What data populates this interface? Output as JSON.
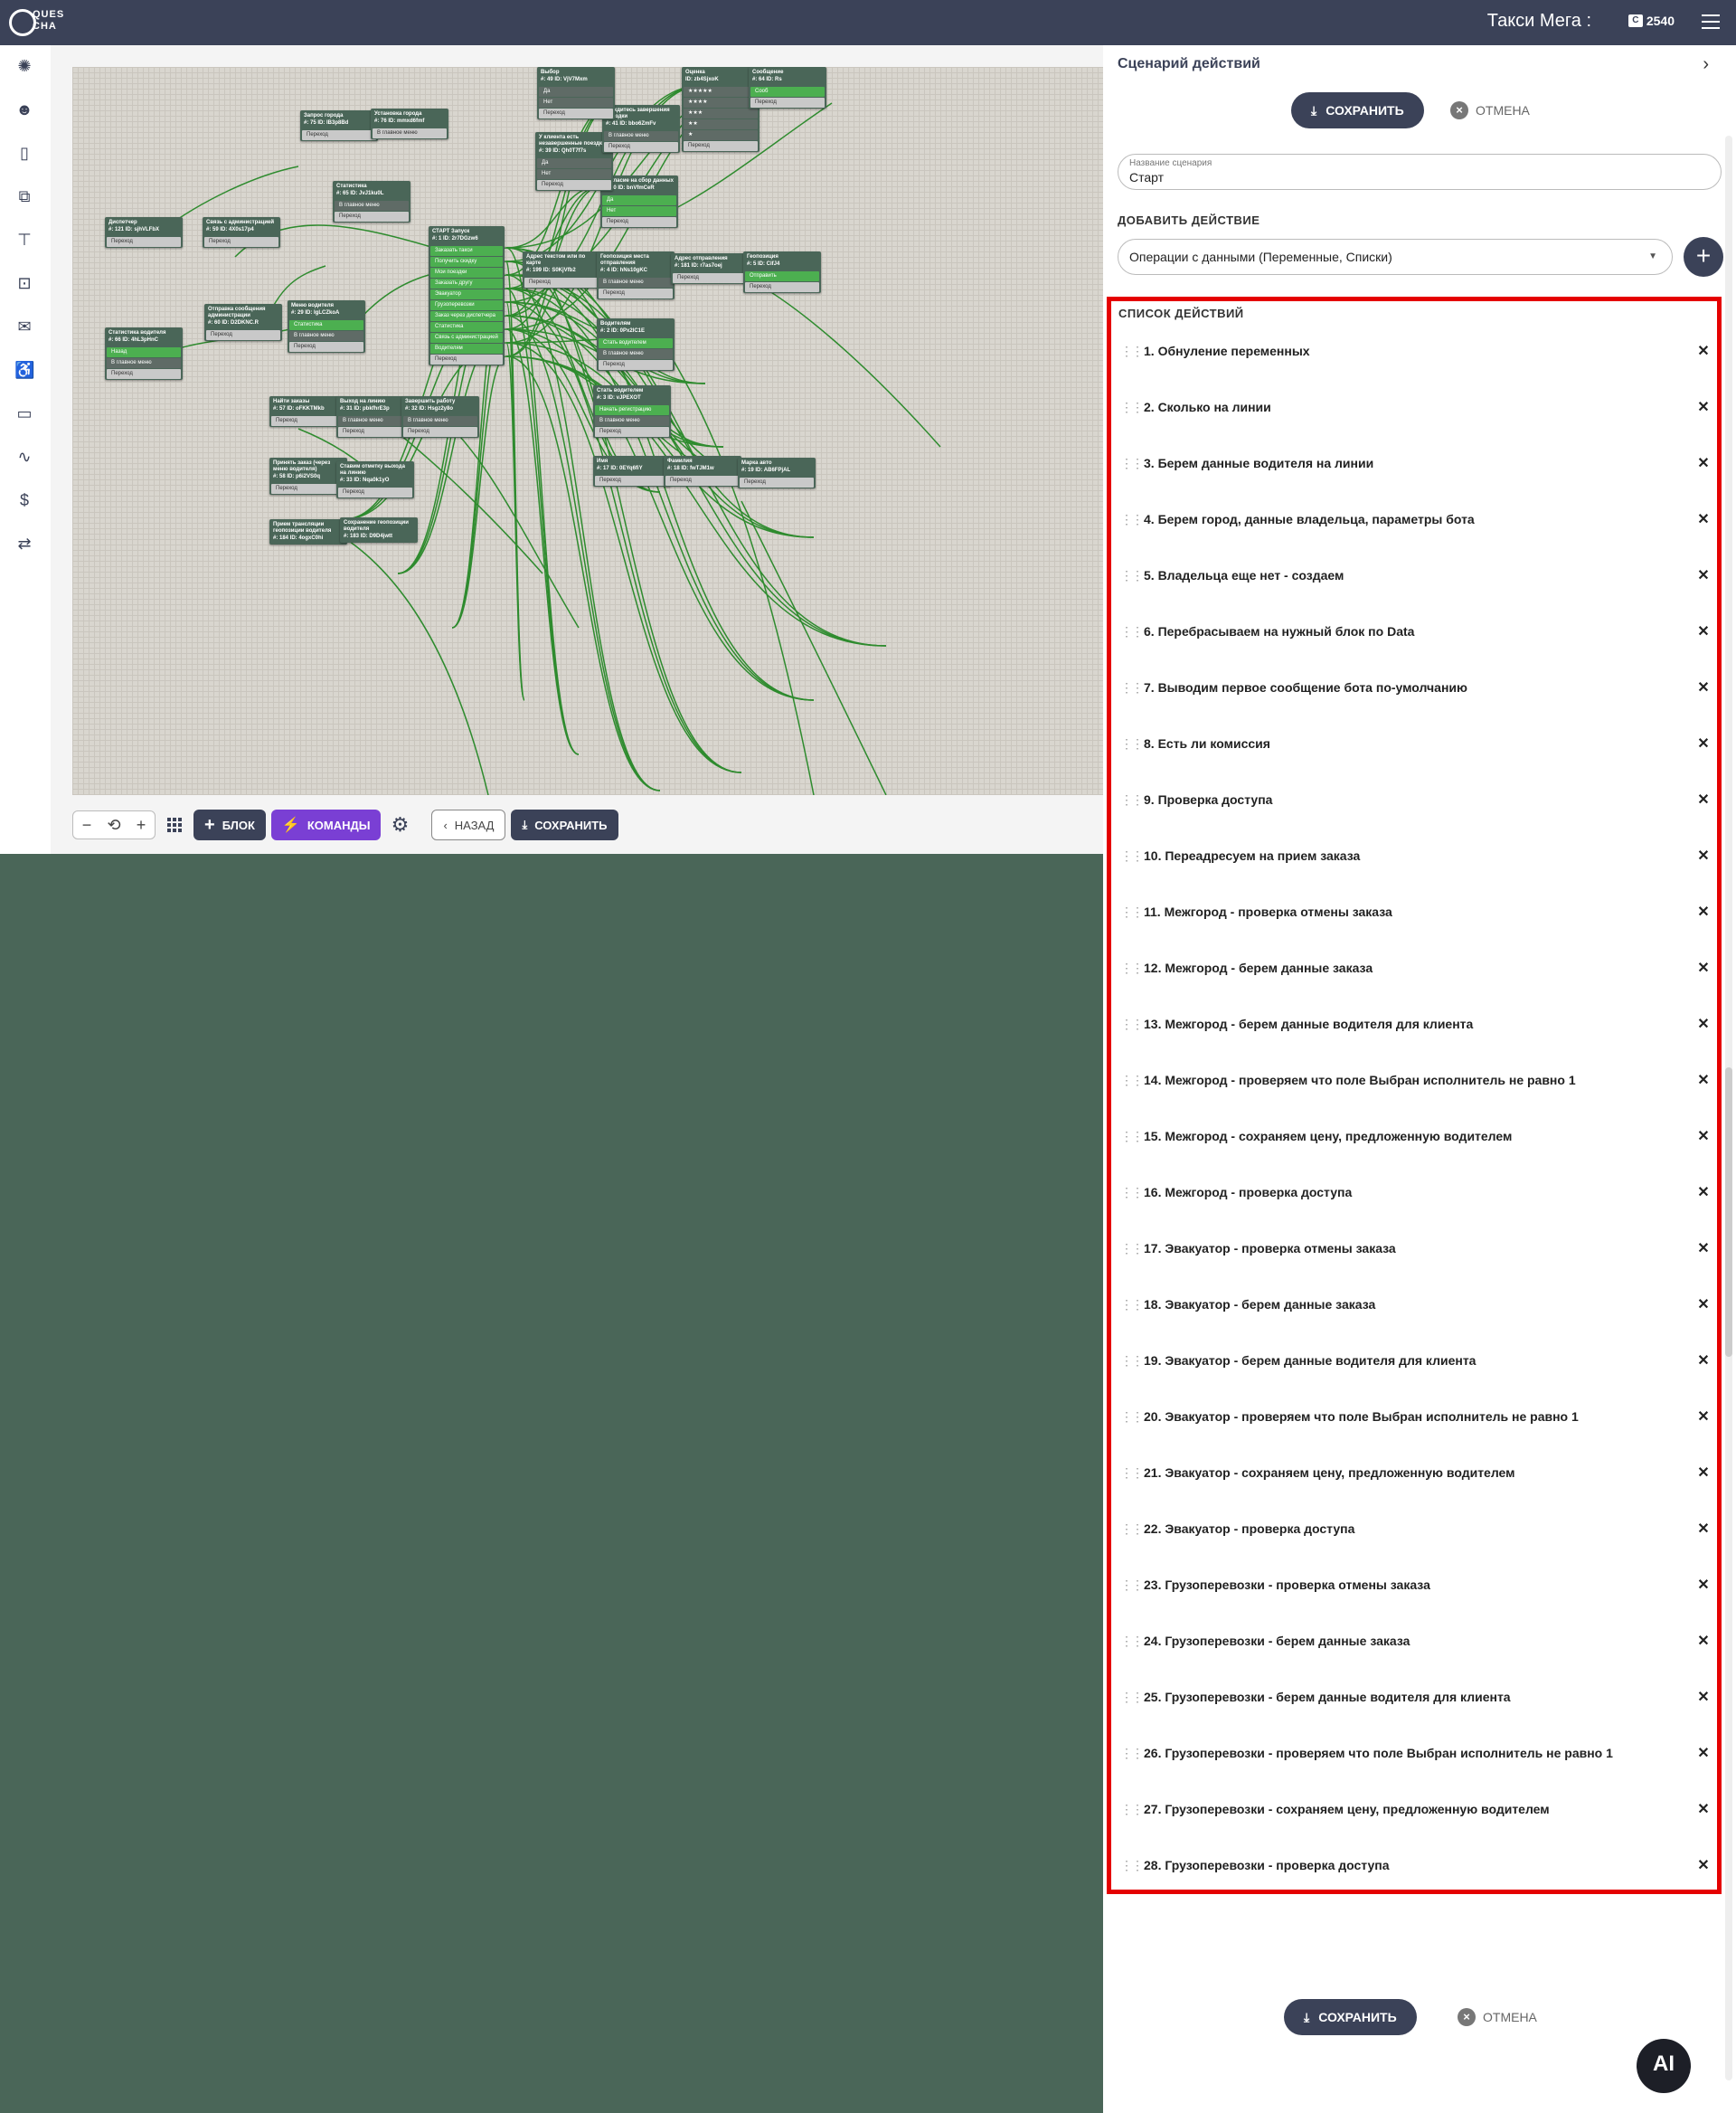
{
  "header": {
    "logo_text": "QUES CHA",
    "brand": "Такси Мега :",
    "balance": "2540",
    "balance_icon": "coin-icon",
    "menu_icon": "hamburger-icon"
  },
  "sidebar": {
    "icons": [
      "palette-icon",
      "robot-icon",
      "phone-icon",
      "flowchart-icon",
      "paint-roller-icon",
      "face-scan-icon",
      "chat-icon",
      "accessibility-icon",
      "card-icon",
      "route-icon",
      "dollar-icon",
      "swap-icon"
    ]
  },
  "canvas": {
    "nodes": [
      {
        "title": "Запрос города",
        "id": "#: 75  ID: lB3p8Bd",
        "buttons": [
          [
            "Переход",
            "n"
          ]
        ]
      },
      {
        "title": "Установка города",
        "id": "#: 76  ID: mmxd6fmf",
        "buttons": [
          [
            "В главное меню",
            "n"
          ]
        ]
      },
      {
        "title": "Статистика",
        "id": "#: 65  ID: JvJ1ku0L",
        "buttons": [
          [
            "В главное меню",
            "d"
          ],
          [
            "Переход",
            "n"
          ]
        ]
      },
      {
        "title": "Диспетчер",
        "id": "#: 121  ID: sjhVLFbX",
        "buttons": [
          [
            "Переход",
            "n"
          ]
        ]
      },
      {
        "title": "Связь с администрацией",
        "id": "#: 59  ID: 4X0s17p4",
        "buttons": [
          [
            "Переход",
            "n"
          ]
        ]
      },
      {
        "title": "Статистика водителя",
        "id": "#: 66  ID: 4hL3pHnC",
        "buttons": [
          [
            "Назад",
            "g"
          ],
          [
            "В главное меню",
            "d"
          ],
          [
            "Переход",
            "n"
          ]
        ]
      },
      {
        "title": "Отправка сообщения администрации",
        "id": "#: 60  ID: D2DKNC.R",
        "buttons": [
          [
            "Переход",
            "n"
          ]
        ]
      },
      {
        "title": "Меню водителя",
        "id": "#: 29  ID: IgLCZkoA",
        "buttons": [
          [
            "Статистика",
            "g"
          ],
          [
            "В главное меню",
            "d"
          ],
          [
            "Переход",
            "n"
          ]
        ]
      },
      {
        "title": "СТАРТ  Запуск",
        "id": "#: 1  ID: 2r7DGzw6",
        "buttons": [
          [
            "Заказать такси",
            "g"
          ],
          [
            "Получить скидку",
            "g"
          ],
          [
            "Мои поездки",
            "g"
          ],
          [
            "Заказать другу",
            "g"
          ],
          [
            "Эвакуатор",
            "g"
          ],
          [
            "Грузоперевозки",
            "g"
          ],
          [
            "Заказ через диспетчера",
            "g"
          ],
          [
            "Статистика",
            "g"
          ],
          [
            "Связь с администрацией",
            "g"
          ],
          [
            "Водителям",
            "g"
          ],
          [
            "Переход",
            "n"
          ]
        ]
      },
      {
        "title": "Найти заказы",
        "id": "#: 57  ID: oFKKTMkb",
        "buttons": [
          [
            "Переход",
            "n"
          ]
        ]
      },
      {
        "title": "Выход на линию",
        "id": "#: 31  ID: pbkfhrE3p",
        "buttons": [
          [
            "В главное меню",
            "d"
          ],
          [
            "Переход",
            "n"
          ]
        ]
      },
      {
        "title": "Завершить работу",
        "id": "#: 32  ID: Hsgz2y8o",
        "buttons": [
          [
            "В главное меню",
            "d"
          ],
          [
            "Переход",
            "n"
          ]
        ]
      },
      {
        "title": "Принять заказ (через меню водителя)",
        "id": "#: 58  ID: p6i2VS0q",
        "buttons": [
          [
            "Переход",
            "n"
          ]
        ]
      },
      {
        "title": "Ставим отметку выхода на линию",
        "id": "#: 33  ID: Nqa0k1yO",
        "buttons": [
          [
            "Переход",
            "n"
          ]
        ]
      },
      {
        "title": "Прием трансляции геопозиции водителя",
        "id": "#: 184  ID: 4ogxC0hi",
        "buttons": []
      },
      {
        "title": "Сохранение геопозиции водителя",
        "id": "#: 183  ID: D9D4jwtt",
        "buttons": []
      },
      {
        "title": "Адрес текстом или по карте",
        "id": "#: 199  ID: S0KjVfb2",
        "buttons": [
          [
            "Переход",
            "n"
          ]
        ]
      },
      {
        "title": "Геопозиция места отправления",
        "id": "#: 4  ID: hNs10gKC",
        "buttons": [
          [
            "В главное меню",
            "d"
          ],
          [
            "Переход",
            "n"
          ]
        ]
      },
      {
        "title": "Адрес отправления",
        "id": "#: 181  ID: r7as7oej",
        "buttons": [
          [
            "Переход",
            "n"
          ]
        ]
      },
      {
        "title": "Геопозиция",
        "id": "#: 5  ID: CifJ4",
        "buttons": [
          [
            "Отправить",
            "g"
          ],
          [
            "Переход",
            "n"
          ]
        ]
      },
      {
        "title": "Водителям",
        "id": "#: 2  ID: 0Px2lC1E",
        "buttons": [
          [
            "Стать водителем",
            "g"
          ],
          [
            "В главное меню",
            "d"
          ],
          [
            "Переход",
            "n"
          ]
        ]
      },
      {
        "title": "Стать водителем",
        "id": "#: 3  ID: vJPEXOT",
        "buttons": [
          [
            "Начать регистрацию",
            "g"
          ],
          [
            "В главное меню",
            "d"
          ],
          [
            "Переход",
            "n"
          ]
        ]
      },
      {
        "title": "Имя",
        "id": "#: 17  ID: 0EYq6fiY",
        "buttons": [
          [
            "Переход",
            "n"
          ]
        ]
      },
      {
        "title": "Фамилия",
        "id": "#: 18  ID: fwTJM1w",
        "buttons": [
          [
            "Переход",
            "n"
          ]
        ]
      },
      {
        "title": "Марка авто",
        "id": "#: 19  ID: AB6FPjAL",
        "buttons": [
          [
            "Переход",
            "n"
          ]
        ]
      },
      {
        "title": "Согласие на сбор данных",
        "id": "#: 80  ID: bnVfmCeR",
        "buttons": [
          [
            "Да",
            "g"
          ],
          [
            "Нет",
            "g"
          ],
          [
            "Переход",
            "n"
          ]
        ]
      },
      {
        "title": "У клиента есть незавершенные поездки",
        "id": "#: 39  ID: Qh0T7f7s",
        "buttons": [
          [
            "Да",
            "d"
          ],
          [
            "Нет",
            "d"
          ],
          [
            "Переход",
            "n"
          ]
        ]
      },
      {
        "title": "Дождитесь завершения поездки",
        "id": "#: 41  ID: bbo6ZmFv",
        "buttons": [
          [
            "В главное меню",
            "d"
          ],
          [
            "Переход",
            "n"
          ]
        ]
      },
      {
        "title": "Выбор",
        "id": "#: 49  ID: VjV7Mxm",
        "buttons": [
          [
            "Да",
            "d"
          ],
          [
            "Нет",
            "d"
          ],
          [
            "Переход",
            "n"
          ]
        ]
      },
      {
        "title": "Оценка",
        "id": "ID: zb4SjxoK",
        "buttons": [
          [
            "★★★★★",
            "d"
          ],
          [
            "★★★★",
            "d"
          ],
          [
            "★★★",
            "d"
          ],
          [
            "★★",
            "d"
          ],
          [
            "★",
            "d"
          ],
          [
            "Переход",
            "n"
          ]
        ]
      },
      {
        "title": "Сообщение",
        "id": "#: 64  ID: Rs",
        "buttons": [
          [
            "Сооб",
            "g"
          ],
          [
            "Переход",
            "n"
          ]
        ]
      }
    ]
  },
  "toolbar": {
    "zoom_out": "−",
    "zoom_reset": "⟲",
    "zoom_in": "+",
    "block_label": "БЛОК",
    "commands_label": "КОМАНДЫ",
    "back_label": "НАЗАД",
    "save_label": "СОХРАНИТЬ"
  },
  "panel": {
    "title": "Сценарий действий",
    "save_label": "СОХРАНИТЬ",
    "cancel_label": "ОТМЕНА",
    "name_label": "Название сценария",
    "name_value": "Старт",
    "add_action_label": "ДОБАВИТЬ ДЕЙСТВИЕ",
    "add_action_select": "Операции с данными (Переменные, Списки)",
    "list_label": "СПИСОК ДЕЙСТВИЙ",
    "actions": [
      "1. Обнуление переменных",
      "2. Сколько на линии",
      "3. Берем данные водителя на линии",
      "4. Берем город, данные владельца, параметры бота",
      "5. Владельца еще нет - создаем",
      "6. Перебрасываем на нужный блок по Data",
      "7. Выводим первое сообщение бота по-умолчанию",
      "8. Есть ли комиссия",
      "9. Проверка доступа",
      "10. Переадресуем на прием заказа",
      "11. Межгород - проверка отмены заказа",
      "12. Межгород - берем данные заказа",
      "13. Межгород - берем данные водителя для клиента",
      "14. Межгород - проверяем что поле Выбран исполнитель не равно 1",
      "15. Межгород - сохраняем цену, предложенную водителем",
      "16. Межгород - проверка доступа",
      "17. Эвакуатор - проверка отмены заказа",
      "18. Эвакуатор - берем данные заказа",
      "19. Эвакуатор - берем данные водителя для клиента",
      "20. Эвакуатор - проверяем что поле Выбран исполнитель не равно 1",
      "21. Эвакуатор - сохраняем цену, предложенную водителем",
      "22. Эвакуатор - проверка доступа",
      "23. Грузоперевозки - проверка отмены заказа",
      "24. Грузоперевозки - берем данные заказа",
      "25. Грузоперевозки - берем данные водителя для клиента",
      "26. Грузоперевозки - проверяем что поле Выбран исполнитель не равно 1",
      "27. Грузоперевозки - сохраняем цену, предложенную водителем",
      "28. Грузоперевозки - проверка доступа"
    ],
    "ai_label": "AI"
  }
}
